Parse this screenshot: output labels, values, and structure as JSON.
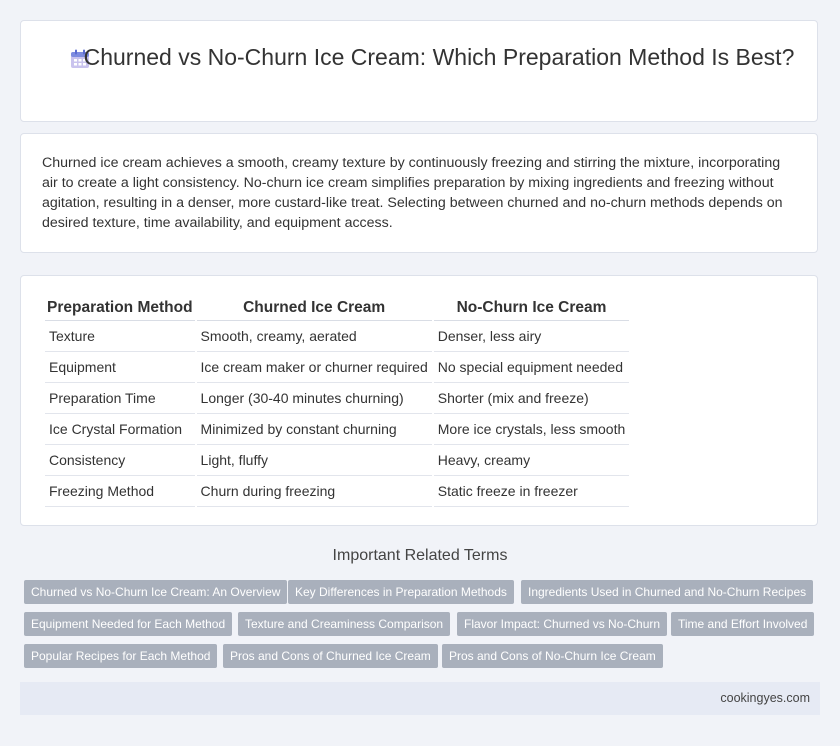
{
  "header": {
    "title": "Churned vs No-Churn Ice Cream: Which Preparation Method Is Best?",
    "icon": "calendar-icon"
  },
  "intro": {
    "text": "Churned ice cream achieves a smooth, creamy texture by continuously freezing and stirring the mixture, incorporating air to create a light consistency. No-churn ice cream simplifies preparation by mixing ingredients and freezing without agitation, resulting in a denser, more custard-like treat. Selecting between churned and no-churn methods depends on desired texture, time availability, and equipment access."
  },
  "table": {
    "headers": [
      "Preparation Method",
      "Churned Ice Cream",
      "No-Churn Ice Cream"
    ],
    "rows": [
      [
        "Texture",
        "Smooth, creamy, aerated",
        "Denser, less airy"
      ],
      [
        "Equipment",
        "Ice cream maker or churner required",
        "No special equipment needed"
      ],
      [
        "Preparation Time",
        "Longer (30-40 minutes churning)",
        "Shorter (mix and freeze)"
      ],
      [
        "Ice Crystal Formation",
        "Minimized by constant churning",
        "More ice crystals, less smooth"
      ],
      [
        "Consistency",
        "Light, fluffy",
        "Heavy, creamy"
      ],
      [
        "Freezing Method",
        "Churn during freezing",
        "Static freeze in freezer"
      ]
    ]
  },
  "related": {
    "title": "Important Related Terms",
    "tags": [
      "Churned vs No-Churn Ice Cream: An Overview",
      "Key Differences in Preparation Methods",
      "Ingredients Used in Churned and No-Churn Recipes",
      "Equipment Needed for Each Method",
      "Texture and Creaminess Comparison",
      "Flavor Impact: Churned vs No-Churn",
      "Time and Effort Involved",
      "Popular Recipes for Each Method",
      "Pros and Cons of Churned Ice Cream",
      "Pros and Cons of No-Churn Ice Cream"
    ]
  },
  "footer": {
    "site": "cookingyes.com"
  }
}
